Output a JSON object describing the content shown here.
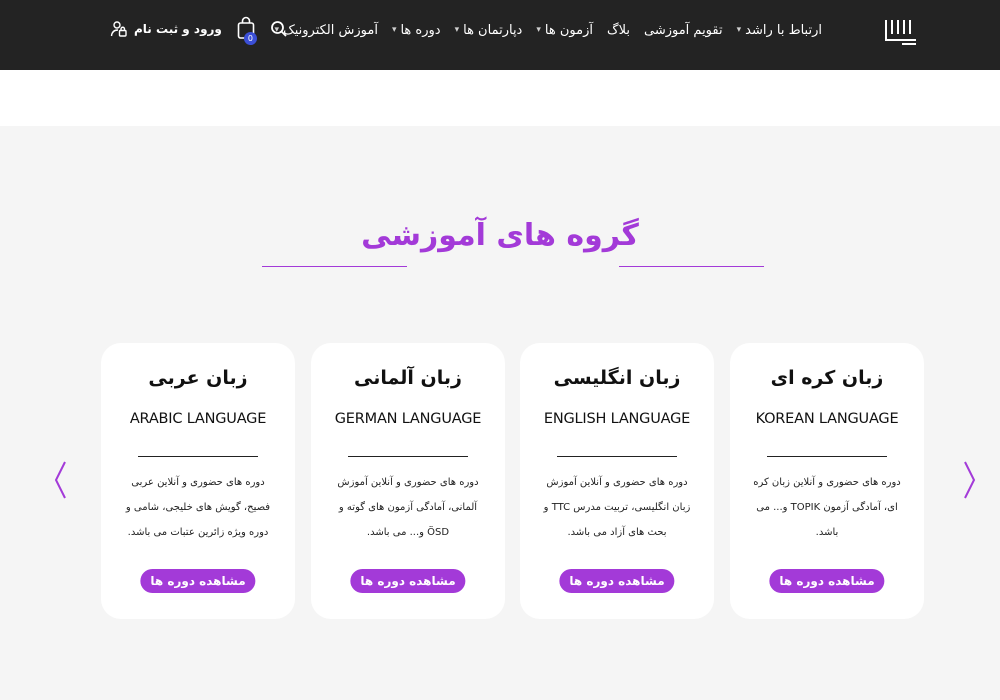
{
  "header": {
    "nav": [
      {
        "label": "آموزش الکترونیک",
        "has_dropdown": true
      },
      {
        "label": "دوره ها",
        "has_dropdown": true
      },
      {
        "label": "دپارتمان ها",
        "has_dropdown": true
      },
      {
        "label": "آزمون ها",
        "has_dropdown": true
      },
      {
        "label": "بلاگ",
        "has_dropdown": false
      },
      {
        "label": "تقویم آموزشی",
        "has_dropdown": false
      },
      {
        "label": "ارتباط با راشد",
        "has_dropdown": true
      }
    ],
    "caret": "▾",
    "login_label": "ورود و ثبت نام",
    "cart_count": "0"
  },
  "section": {
    "title": "گروه های آموزشی"
  },
  "cards": [
    {
      "title": "زبان کره ای",
      "subtitle": "KOREAN LANGUAGE",
      "description": "دوره های حضوری و آنلاین زبان کره ای، آمادگی آزمون TOPIK و... می باشد.",
      "button": "مشاهده دوره ها"
    },
    {
      "title": "زبان انگلیسی",
      "subtitle": "ENGLISH LANGUAGE",
      "description": "دوره های حضوری و آنلاین آموزش زبان انگلیسی، تربیت مدرس TTC و بحث های آزاد می باشد.",
      "button": "مشاهده دوره ها"
    },
    {
      "title": "زبان آلمانی",
      "subtitle": "GERMAN LANGUAGE",
      "description": "دوره های حضوری و آنلاین آموزش آلمانی، آمادگی آزمون های گوته و ÖSD و... می باشد.",
      "button": "مشاهده دوره ها"
    },
    {
      "title": "زبان عربی",
      "subtitle": "ARABIC LANGUAGE",
      "description": "دوره های حضوری و آنلاین عربی فصیح، گویش های خلیجی، شامی و دوره ویژه زائرین عتبات می باشد.",
      "button": "مشاهده دوره ها"
    }
  ],
  "colors": {
    "header_bg": "#232323",
    "accent": "#a33ad8",
    "page_bg": "#f5f5f5",
    "badge": "#3b4fd6"
  },
  "icons": {
    "logo": "rashed-logo-icon",
    "search": "search-icon",
    "cart": "shopping-bag-icon",
    "user": "user-lock-icon",
    "prev": "chevron-left-icon",
    "next": "chevron-right-icon"
  }
}
